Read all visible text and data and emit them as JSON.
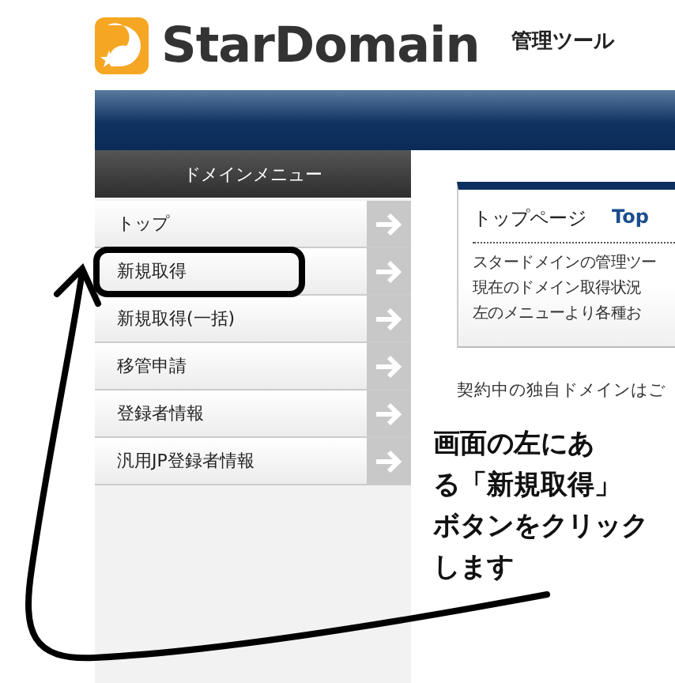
{
  "logo": {
    "name": "StarDomain",
    "subtitle": "管理ツール"
  },
  "sidebar": {
    "title": "ドメインメニュー",
    "items": [
      {
        "label": "トップ"
      },
      {
        "label": "新規取得"
      },
      {
        "label": "新規取得(一括)"
      },
      {
        "label": "移管申請"
      },
      {
        "label": "登録者情報"
      },
      {
        "label": "汎用JP登録者情報"
      }
    ]
  },
  "panel": {
    "title": "トップページ",
    "title_en": "Top",
    "lines": [
      "スタードメインの管理ツー",
      "現在のドメイン取得状況",
      "左のメニューより各種お"
    ]
  },
  "notice": "契約中の独自ドメインはご",
  "annotation": {
    "lines": [
      "画面の左にあ",
      "る「新規取得」",
      "ボタンをクリック",
      "します"
    ]
  }
}
